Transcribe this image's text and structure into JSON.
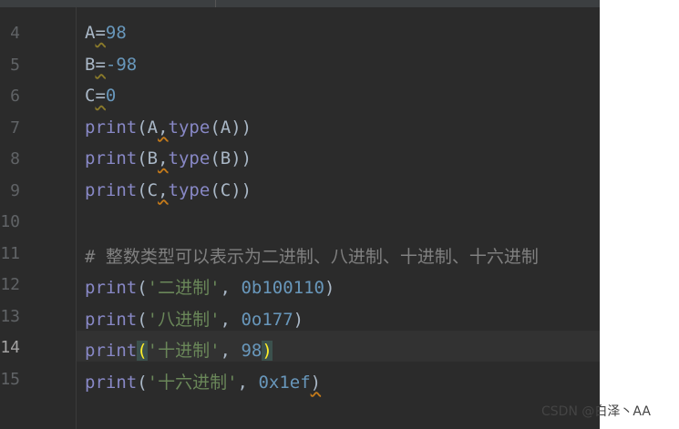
{
  "editor": {
    "lines": [
      {
        "number": "4",
        "tokens": [
          {
            "t": "A",
            "c": "id"
          },
          {
            "t": "=",
            "c": "sq"
          },
          {
            "t": "98",
            "c": "num"
          }
        ]
      },
      {
        "number": "5",
        "tokens": [
          {
            "t": "B",
            "c": "id"
          },
          {
            "t": "=",
            "c": "sq"
          },
          {
            "t": "-98",
            "c": "num"
          }
        ]
      },
      {
        "number": "6",
        "tokens": [
          {
            "t": "C",
            "c": "id"
          },
          {
            "t": "=",
            "c": "sq"
          },
          {
            "t": "0",
            "c": "num"
          }
        ]
      },
      {
        "number": "7",
        "tokens": [
          {
            "t": "print",
            "c": "kw"
          },
          {
            "t": "(A",
            "c": "id"
          },
          {
            "t": ",",
            "c": "sqr"
          },
          {
            "t": "type",
            "c": "kw"
          },
          {
            "t": "(A))",
            "c": "id"
          }
        ]
      },
      {
        "number": "8",
        "tokens": [
          {
            "t": "print",
            "c": "kw"
          },
          {
            "t": "(B",
            "c": "id"
          },
          {
            "t": ",",
            "c": "sqr"
          },
          {
            "t": "type",
            "c": "kw"
          },
          {
            "t": "(B))",
            "c": "id"
          }
        ]
      },
      {
        "number": "9",
        "tokens": [
          {
            "t": "print",
            "c": "kw"
          },
          {
            "t": "(C",
            "c": "id"
          },
          {
            "t": ",",
            "c": "sqr"
          },
          {
            "t": "type",
            "c": "kw"
          },
          {
            "t": "(C))",
            "c": "id"
          }
        ]
      },
      {
        "number": "10",
        "tokens": []
      },
      {
        "number": "11",
        "tokens": [
          {
            "t": "# 整数类型可以表示为二进制、八进制、十进制、十六进制",
            "c": "cmt"
          }
        ]
      },
      {
        "number": "12",
        "tokens": [
          {
            "t": "print",
            "c": "kw"
          },
          {
            "t": "(",
            "c": "id"
          },
          {
            "t": "'二进制'",
            "c": "str"
          },
          {
            "t": ", ",
            "c": "id"
          },
          {
            "t": "0b100110",
            "c": "num"
          },
          {
            "t": ")",
            "c": "id"
          }
        ]
      },
      {
        "number": "13",
        "tokens": [
          {
            "t": "print",
            "c": "kw"
          },
          {
            "t": "(",
            "c": "id"
          },
          {
            "t": "'八进制'",
            "c": "str"
          },
          {
            "t": ", ",
            "c": "id"
          },
          {
            "t": "0o177",
            "c": "num"
          },
          {
            "t": ")",
            "c": "id"
          }
        ]
      },
      {
        "number": "14",
        "active": true,
        "tokens": [
          {
            "t": "print",
            "c": "kw"
          },
          {
            "t": "(",
            "c": "brace"
          },
          {
            "t": "'十进制'",
            "c": "str"
          },
          {
            "t": ", ",
            "c": "id"
          },
          {
            "t": "98",
            "c": "num"
          },
          {
            "t": ")",
            "c": "brace"
          }
        ]
      },
      {
        "number": "15",
        "tokens": [
          {
            "t": "print",
            "c": "kw"
          },
          {
            "t": "(",
            "c": "id"
          },
          {
            "t": "'十六进制'",
            "c": "str"
          },
          {
            "t": ", ",
            "c": "id"
          },
          {
            "t": "0x1ef",
            "c": "num"
          },
          {
            "t": ")",
            "c": "sqr"
          }
        ]
      }
    ]
  },
  "watermark": "CSDN @白泽丶AA",
  "colors": {
    "background": "#2b2b2b",
    "keyword": "#8888c6",
    "number": "#6897bb",
    "string": "#6a8759",
    "comment": "#808080",
    "identifier": "#a9b7c6",
    "brace_match": "#ffef28"
  }
}
